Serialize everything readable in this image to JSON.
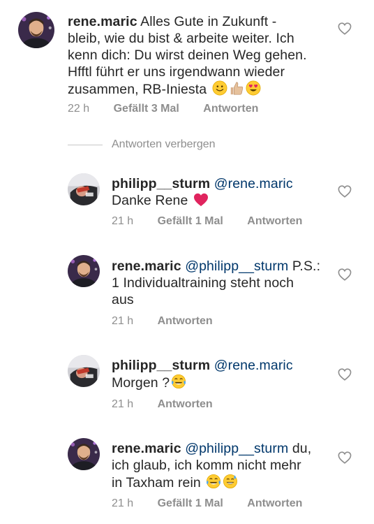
{
  "comments": [
    {
      "username": "rene.maric",
      "mention": "",
      "text": "Alles Gute in Zukunft - bleib, wie du bist & arbeite weiter. Ich kenn dich: Du wirst deinen Weg gehen. Hfftl führt er uns irgendwann wieder zusammen, RB-Iniesta",
      "line1": "Alles Gute in Zukunft -",
      "line2": "bleib, wie du bist & arbeite weiter. Ich",
      "line3": "kenn dich: Du wirst deinen Weg gehen.",
      "line4": "Hfftl führt er uns irgendwann wieder",
      "line5": "zusammen, RB-Iniesta",
      "emojis": [
        "slightly-smiling-face",
        "thumbs-up-medium-light",
        "heart-eyes"
      ],
      "time": "22 h",
      "likes": "Gefällt 3 Mal",
      "reply": "Antworten"
    },
    {
      "username": "philipp__sturm",
      "mention": "@rene.maric",
      "line2": "Danke Rene",
      "emojis": [
        "red-heart"
      ],
      "time": "21 h",
      "likes": "Gefällt 1 Mal",
      "reply": "Antworten"
    },
    {
      "username": "rene.maric",
      "mention": "@philipp__sturm",
      "line1tail": "P.S.:",
      "line2": "1 Individualtraining steht noch",
      "line3": "aus",
      "time": "21 h",
      "reply": "Antworten"
    },
    {
      "username": "philipp__sturm",
      "mention": "@rene.maric",
      "line2": "Morgen ?",
      "emojis": [
        "tears-of-joy"
      ],
      "time": "21 h",
      "reply": "Antworten"
    },
    {
      "username": "rene.maric",
      "mention": "@philipp__sturm",
      "line1tail": "du,",
      "line2": "ich glaub, ich komm nicht mehr",
      "line3": "in Taxham rein",
      "emojis": [
        "tears-of-joy",
        "grinning-sweat"
      ],
      "time": "21 h",
      "likes": "Gefällt 1 Mal",
      "reply": "Antworten"
    }
  ],
  "replies_toggle": "Antworten verbergen",
  "colors": {
    "text": "#262626",
    "meta": "#8e8e8e",
    "mention": "#00376b",
    "heart_outline": "#8e8e8e",
    "red_heart": "#e0245e"
  }
}
